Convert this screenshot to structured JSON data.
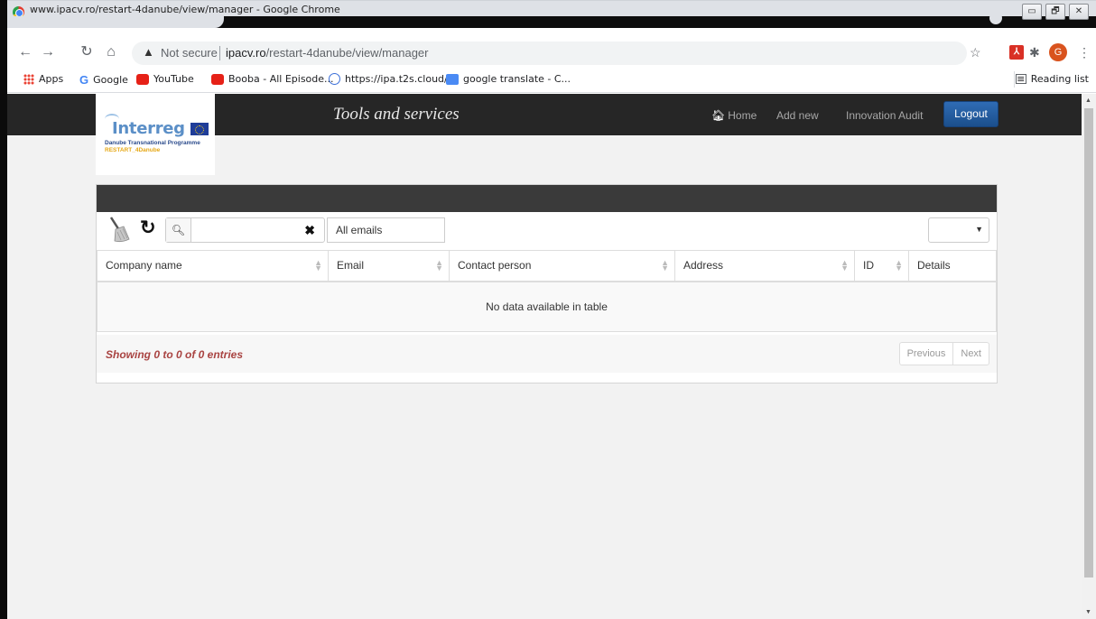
{
  "window": {
    "title": "www.ipacv.ro/restart-4danube/view/manager - Google Chrome",
    "buttons": [
      "▭",
      "🗗",
      "✕"
    ]
  },
  "toolbar": {
    "security_warning_icon": "warning-triangle-icon",
    "security_label": "Not secure",
    "url_host": "ipacv.ro",
    "url_path": "/restart-4danube/view/manager"
  },
  "bookmarks": {
    "items": [
      {
        "label": "Apps",
        "icon": "apps-grid-icon"
      },
      {
        "label": "Google",
        "icon": "google-icon"
      },
      {
        "label": "YouTube",
        "icon": "youtube-icon"
      },
      {
        "label": "Booba - All Episode...",
        "icon": "youtube-icon"
      },
      {
        "label": "https://ipa.t2s.cloud/",
        "icon": "t2s-icon"
      },
      {
        "label": "google translate - C...",
        "icon": "google-translate-icon"
      }
    ],
    "reading_list": "Reading list"
  },
  "profile_initial": "G",
  "site": {
    "logo_text": "Interreg",
    "logo_sub1": "Danube Transnational Programme",
    "logo_sub2": "RESTART_4Danube",
    "title": "Tools and services",
    "nav": {
      "home": "Home",
      "add_new": "Add new",
      "innovation_audit": "Innovation Audit",
      "logout": "Logout"
    }
  },
  "table": {
    "search_value": "",
    "filter_label": "All emails",
    "length_value": "",
    "columns": [
      "Company name",
      "Email",
      "Contact person",
      "Address",
      "ID",
      "Details"
    ],
    "empty_message": "No data available in table",
    "info": "Showing 0 to 0 of 0 entries",
    "pager": {
      "previous": "Previous",
      "next": "Next"
    }
  },
  "colors": {
    "navbar": "#262626",
    "panel_header": "#3a3a3a",
    "logout_button": "#1f5899",
    "info_text": "#a94442"
  }
}
